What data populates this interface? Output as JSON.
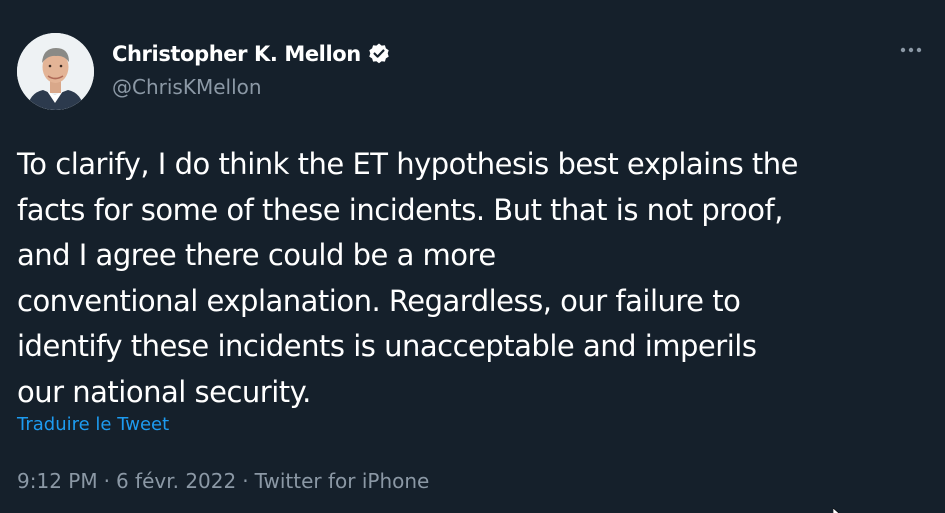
{
  "author": {
    "name": "Christopher K. Mellon",
    "handle": "@ChrisKMellon",
    "avatar_icon": "profile-photo",
    "verified_icon": "verified-badge-icon"
  },
  "tweet": {
    "lines": [
      "To clarify, I do think the ET hypothesis best explains the",
      "facts for some of these incidents. But that is not proof,",
      "and I agree there could be a more",
      "conventional explanation. Regardless, our failure to",
      "identify these incidents is unacceptable and imperils",
      "our national security."
    ],
    "translate_label": "Traduire le Tweet"
  },
  "meta": {
    "time": "9:12 PM",
    "separator": "·",
    "date": "6 févr. 2022",
    "source": "Twitter for iPhone"
  },
  "icons": {
    "more": "more-options-icon",
    "cursor": "mouse-cursor-icon"
  },
  "colors": {
    "background": "#15202b",
    "text_primary": "#ffffff",
    "text_secondary": "#8b98a5",
    "link": "#1d9bf0"
  }
}
